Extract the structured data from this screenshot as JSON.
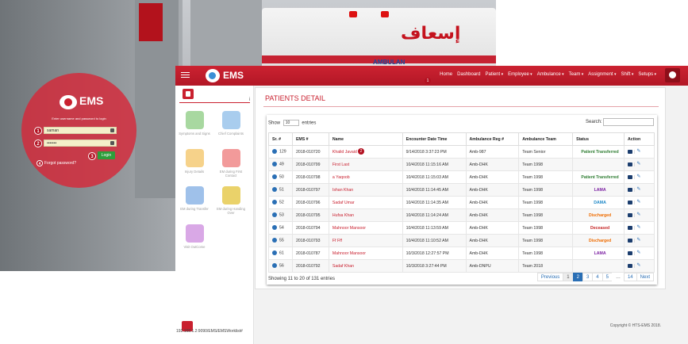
{
  "login": {
    "title": "EMS",
    "subtitle": "Enter username and password to login",
    "username_value": "saman",
    "password_value": "•••••••",
    "login_label": "Login",
    "forgot_label": "Forgot password?",
    "badges": [
      "1",
      "2",
      "3",
      "4"
    ]
  },
  "photo": {
    "arabic_text": "إسعاف",
    "ambulance_text": "AMBULAN"
  },
  "header": {
    "brand": "EMS",
    "nav": [
      {
        "label": "Home",
        "dropdown": false
      },
      {
        "label": "Dashboard",
        "dropdown": false
      },
      {
        "label": "Patient",
        "dropdown": true
      },
      {
        "label": "Employee",
        "dropdown": true
      },
      {
        "label": "Ambulance",
        "dropdown": true
      },
      {
        "label": "Team",
        "dropdown": true
      },
      {
        "label": "Assignment",
        "dropdown": true
      },
      {
        "label": "Shift",
        "dropdown": true
      },
      {
        "label": "Setups",
        "dropdown": true
      }
    ],
    "home_badge": "1"
  },
  "sidebar": {
    "info_icon": "i",
    "tiles": [
      {
        "label": "Symptoms and Signs",
        "color": "#a8d8a0"
      },
      {
        "label": "Chief Complaints",
        "color": "#a9cdee"
      },
      {
        "label": "Injury Details",
        "color": "#f6d28a"
      },
      {
        "label": "EM during First Contact",
        "color": "#f29a9a"
      },
      {
        "label": "EM during Transfer",
        "color": "#9fc1ea"
      },
      {
        "label": "EM during Handing Over",
        "color": "#ead26a"
      },
      {
        "label": "Visit OutCome",
        "color": "#d9a8e6"
      }
    ]
  },
  "panel": {
    "title": "PATIENTS DETAIL",
    "show_label": "Show",
    "show_value": "10",
    "entries_label": "entries",
    "search_label": "Search:",
    "name_badge": "2",
    "columns": [
      "Sr. #",
      "EMS #",
      "Name",
      "Encounter Date Time",
      "Ambulance Reg #",
      "Ambulance Team",
      "Status",
      "Action"
    ],
    "rows": [
      {
        "sr": "129",
        "ems": "2018-010720",
        "name": "Khalid Javaid",
        "date": "9/14/2018 3:37:23 PM",
        "reg": "Amb-987",
        "team": "Team Senior",
        "status": "Patient Transferred",
        "status_class": "st-transferred"
      },
      {
        "sr": "49",
        "ems": "2018-010799",
        "name": "First Last",
        "date": "10/4/2018 11:15:16 AM",
        "reg": "Amb-DHK",
        "team": "Team 1998",
        "status": "",
        "status_class": ""
      },
      {
        "sr": "50",
        "ems": "2018-010798",
        "name": "a Yaqoob",
        "date": "10/4/2018 11:15:03 AM",
        "reg": "Amb-DHK",
        "team": "Team 1998",
        "status": "Patient Transferred",
        "status_class": "st-transferred"
      },
      {
        "sr": "51",
        "ems": "2018-010797",
        "name": "Ishan Khan",
        "date": "10/4/2018 11:14:45 AM",
        "reg": "Amb-DHK",
        "team": "Team 1998",
        "status": "LAMA",
        "status_class": "st-lama"
      },
      {
        "sr": "52",
        "ems": "2018-010796",
        "name": "Sadaf Umar",
        "date": "10/4/2018 11:14:35 AM",
        "reg": "Amb-DHK",
        "team": "Team 1998",
        "status": "DAMA",
        "status_class": "st-dama"
      },
      {
        "sr": "53",
        "ems": "2018-010795",
        "name": "Hufsa Khan",
        "date": "10/4/2018 11:14:24 AM",
        "reg": "Amb-DHK",
        "team": "Team 1998",
        "status": "Discharged",
        "status_class": "st-discharged"
      },
      {
        "sr": "54",
        "ems": "2018-010794",
        "name": "Mahnoor Mansoor",
        "date": "10/4/2018 11:13:59 AM",
        "reg": "Amb-DHK",
        "team": "Team 1998",
        "status": "Deceased",
        "status_class": "st-deceased"
      },
      {
        "sr": "55",
        "ems": "2018-010793",
        "name": "Ff Fff",
        "date": "10/4/2018 11:10:52 AM",
        "reg": "Amb-DHK",
        "team": "Team 1998",
        "status": "Discharged",
        "status_class": "st-discharged"
      },
      {
        "sr": "61",
        "ems": "2018-010787",
        "name": "Mahnoor Mansoor",
        "date": "10/3/2018 12:27:57 PM",
        "reg": "Amb-DHK",
        "team": "Team 1998",
        "status": "LAMA",
        "status_class": "st-lama"
      },
      {
        "sr": "56",
        "ems": "2018-010792",
        "name": "Sadaf Khan",
        "date": "10/3/2018 3:27:44 PM",
        "reg": "Amb-DNPU",
        "team": "Team 2018",
        "status": "",
        "status_class": ""
      }
    ],
    "entries_info": "Showing 11 to 20 of 131 entries",
    "pager": [
      {
        "label": "Previous",
        "cls": ""
      },
      {
        "label": "1",
        "cls": "cur1"
      },
      {
        "label": "2",
        "cls": "active"
      },
      {
        "label": "3",
        "cls": ""
      },
      {
        "label": "4",
        "cls": ""
      },
      {
        "label": "5",
        "cls": ""
      },
      {
        "label": "…",
        "cls": "plain"
      },
      {
        "label": "14",
        "cls": ""
      },
      {
        "label": "Next",
        "cls": ""
      }
    ]
  },
  "status_url": "192.168.1.2:9090/EMS/EMSWorklist#",
  "copyright": "Copyright © HTS-EMS 2018."
}
